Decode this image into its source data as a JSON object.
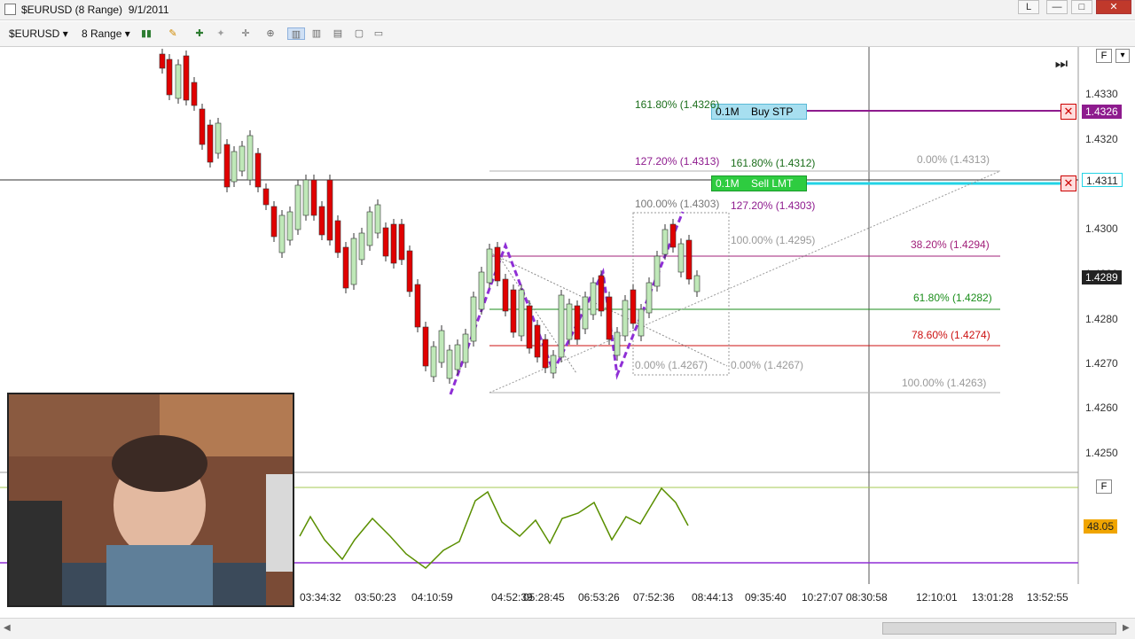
{
  "window": {
    "title": "$EURUSD (8 Range)  9/1/2011",
    "controls": [
      "L",
      "—",
      "□",
      "✕"
    ]
  },
  "toolbar": {
    "instrument": "$EURUSD",
    "bar_type": "8 Range"
  },
  "chart": {
    "price_labels": [
      "1.4330",
      "1.4320",
      "1.4310",
      "1.4300",
      "1.4290",
      "1.4280",
      "1.4270",
      "1.4260",
      "1.4250"
    ],
    "time_labels": [
      "03:34:32",
      "03:50:23",
      "04:10:59",
      "04:52:39",
      "05:28:45",
      "06:53:26",
      "07:52:36",
      "08:44:13",
      "09:35:40",
      "10:27:07",
      "08:30:58",
      "12:10:01",
      "13:01:28",
      "13:52:55"
    ],
    "current_price": "1.4289",
    "buy_order": {
      "qty": "0.1M",
      "label": "Buy STP",
      "price": "1.4326"
    },
    "sell_order": {
      "qty": "0.1M",
      "label": "Sell LMT",
      "price": "1.4311"
    },
    "fib_labels": {
      "f1": "161.80% (1.4326)",
      "f2": "127.20% (1.4313)",
      "f3": "161.80% (1.4312)",
      "f4": "100.00% (1.4303)",
      "f5": "127.20% (1.4303)",
      "f6": "100.00% (1.4295)",
      "f7": "0.00% (1.4313)",
      "f8": "38.20% (1.4294)",
      "f9": "61.80% (1.4282)",
      "f10": "78.60% (1.4274)",
      "f11": "0.00% (1.4267)",
      "f12": "0.00% (1.4267)",
      "f13": "100.00% (1.4263)"
    },
    "indicator_value": "48.05",
    "panel_button": "F",
    "colors": {
      "up_candle": "#bfe8b8",
      "down_candle": "#e00000",
      "buy_line": "#8e1b8e",
      "sell_line": "#22d3e6",
      "indicator": "#5a8f00",
      "pattern": "#8f2fd6"
    }
  }
}
